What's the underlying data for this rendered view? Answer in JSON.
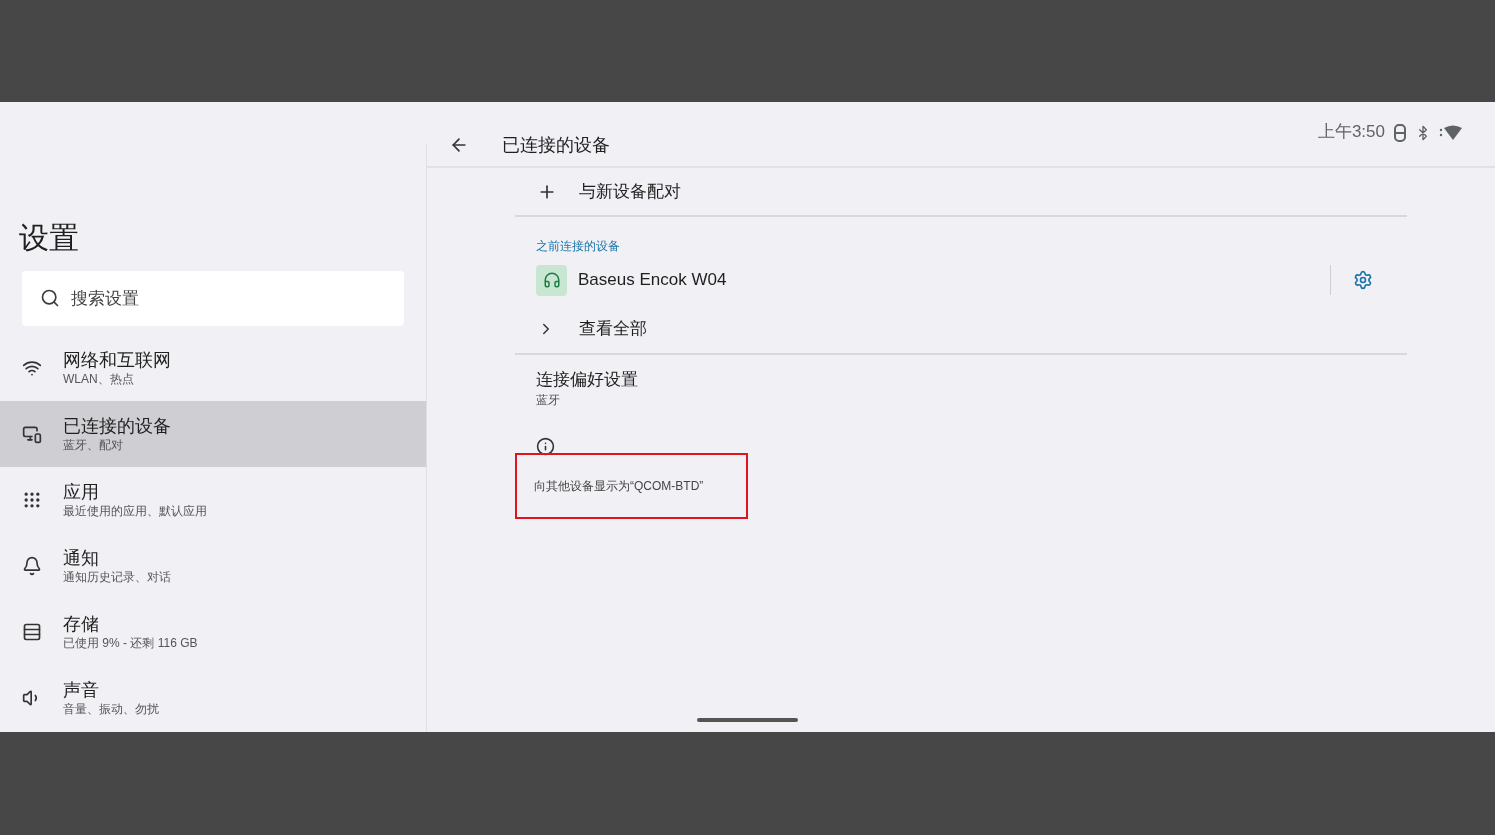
{
  "status_bar": {
    "time": "上午3:50"
  },
  "sidebar": {
    "title": "设置",
    "search": {
      "placeholder": "搜索设置"
    },
    "items": [
      {
        "title": "网络和互联网",
        "subtitle": "WLAN、热点",
        "selected": false
      },
      {
        "title": "已连接的设备",
        "subtitle": "蓝牙、配对",
        "selected": true
      },
      {
        "title": "应用",
        "subtitle": "最近使用的应用、默认应用",
        "selected": false
      },
      {
        "title": "通知",
        "subtitle": "通知历史记录、对话",
        "selected": false
      },
      {
        "title": "存储",
        "subtitle": "已使用 9% - 还剩 116 GB",
        "selected": false
      },
      {
        "title": "声音",
        "subtitle": "音量、振动、勿扰",
        "selected": false
      }
    ]
  },
  "page": {
    "title": "已连接的设备",
    "pair_new": "与新设备配对",
    "section_label": "之前连接的设备",
    "device": {
      "name": "Baseus Encok W04"
    },
    "see_all": "查看全部",
    "preferences": {
      "title": "连接偏好设置",
      "subtitle": "蓝牙"
    },
    "info_text": "向其他设备显示为“QCOM-BTD”",
    "info_highlighted": true
  }
}
